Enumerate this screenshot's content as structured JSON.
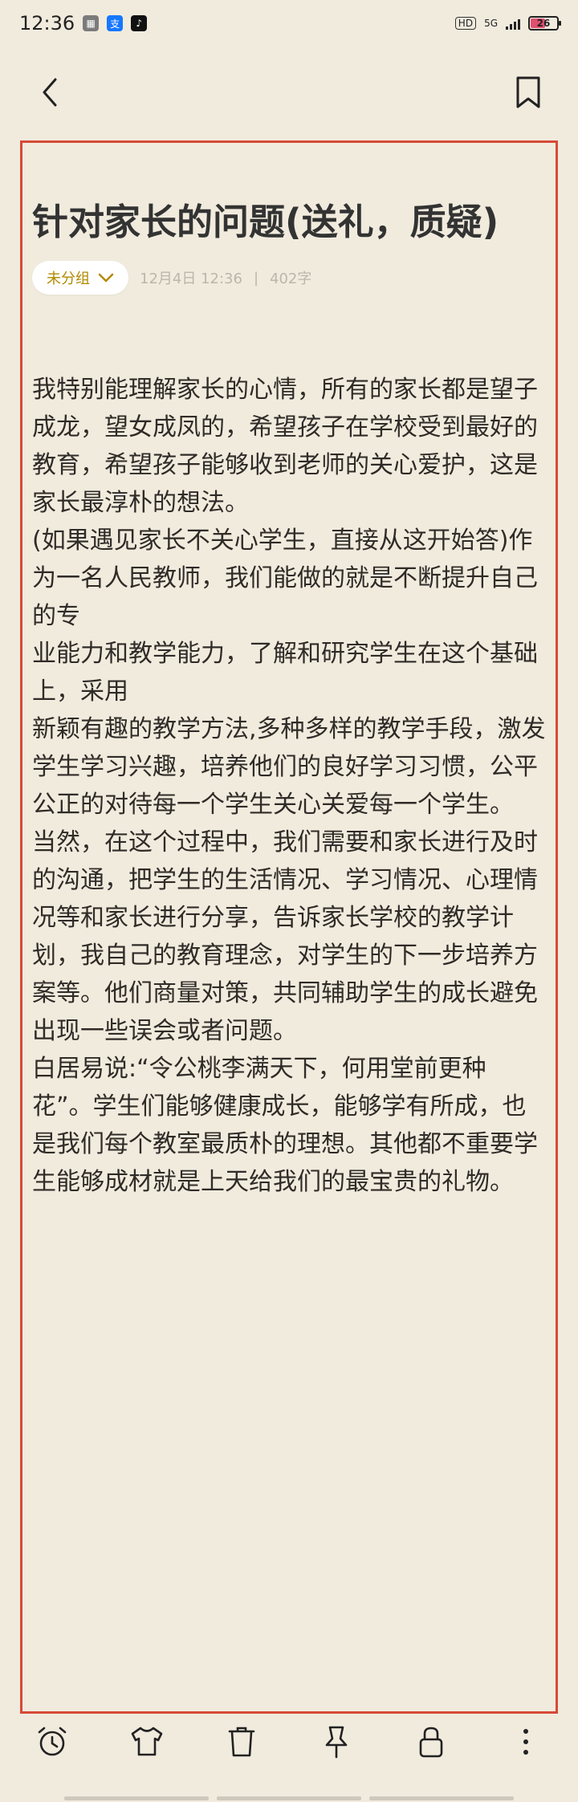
{
  "status_bar": {
    "time": "12:36",
    "hd": "HD",
    "network": "5G",
    "battery": "26"
  },
  "note": {
    "title": "针对家长的问题(送礼，质疑)",
    "group_label": "未分组",
    "date": "12月4日 12:36",
    "separator": "|",
    "word_count": "402字",
    "paragraphs": [
      "我特别能理解家长的心情，所有的家长都是望子成龙，望女成凤的，希望孩子在学校受到最好的教育，希望孩子能够收到老师的关心爱护，这是家长最淳朴的想法。",
      "(如果遇见家长不关心学生，直接从这开始答)作为一名人民教师，我们能做的就是不断提升自己的专",
      "业能力和教学能力，了解和研究学生在这个基础上，采用",
      "新颖有趣的教学方法,多种多样的教学手段，激发学生学习兴趣，培养他们的良好学习习惯，公平公正的对待每一个学生关心关爱每一个学生。",
      "当然，在这个过程中，我们需要和家长进行及时的沟通，把学生的生活情况、学习情况、心理情况等和家长进行分享，告诉家长学校的教学计划，我自己的教育理念，对学生的下一步培养方案等。他们商量对策，共同辅助学生的成长避免出现一些误会或者问题。",
      "白居易说:“令公桃李满天下，何用堂前更种花”。学生们能够健康成长，能够学有所成，也是我们每个教室最质朴的理想。其他都不重要学生能够成材就是上天给我们的最宝贵的礼物。"
    ]
  },
  "icons": {
    "back": "back-icon",
    "bookmark": "bookmark-icon",
    "alarm": "alarm-clock-icon",
    "theme": "shirt-icon",
    "delete": "trash-icon",
    "pin": "pin-icon",
    "lock": "lock-icon",
    "more": "more-vertical-icon"
  },
  "colors": {
    "background": "#f1ebde",
    "border": "#d64a36",
    "group_text": "#b18a00",
    "meta_text": "#bcb6aa"
  }
}
